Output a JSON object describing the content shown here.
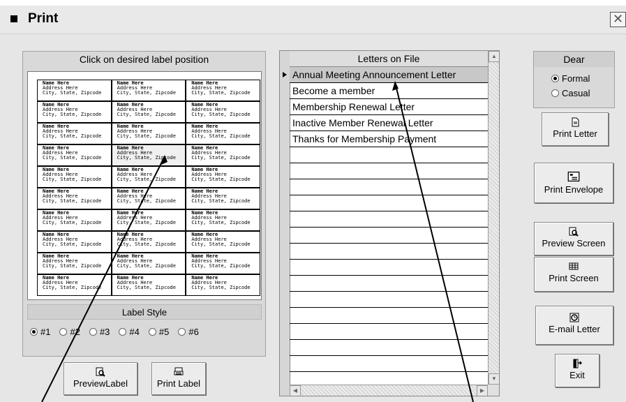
{
  "window": {
    "title": "Print",
    "close_glyph": "✕"
  },
  "labels_panel": {
    "heading": "Click on desired label position",
    "label_lines": [
      "Name Here",
      "Address Here",
      "City, State, Zipcode"
    ],
    "label_style_heading": "Label Style",
    "styles": [
      "#1",
      "#2",
      "#3",
      "#4",
      "#5",
      "#6"
    ],
    "selected_style": "#1",
    "preview_label_button": "PreviewLabel",
    "print_label_button": "Print Label"
  },
  "letters_grid": {
    "column_header": "Letters on File",
    "rows": [
      "Annual Meeting Announcement Letter",
      "Become a member",
      "Membership Renewal Letter",
      "Inactive Member Renewal Letter",
      "Thanks for Membership Payment",
      "",
      "",
      "",
      "",
      "",
      "",
      "",
      "",
      "",
      "",
      "",
      "",
      "",
      "",
      ""
    ],
    "selected_row": 0
  },
  "dear": {
    "heading": "Dear",
    "options": [
      "Formal",
      "Casual"
    ],
    "selected": "Formal"
  },
  "buttons": {
    "print_letter": "Print  Letter",
    "print_envelope": "Print Envelope",
    "preview_screen": "Preview Screen",
    "print_screen": "Print Screen",
    "email_letter": "E-mail Letter",
    "exit": "Exit"
  }
}
